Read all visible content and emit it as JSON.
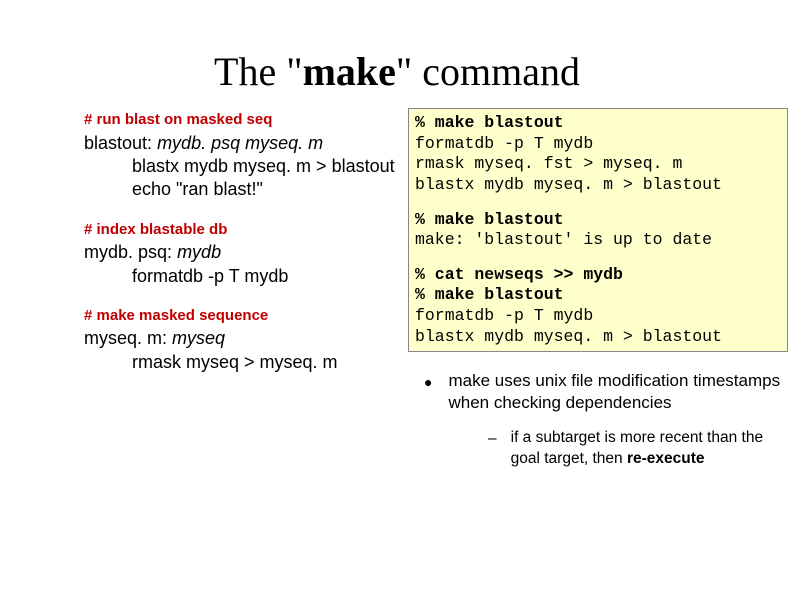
{
  "title_pre": "The \"",
  "title_bold": "make",
  "title_post": "\" command",
  "left": {
    "c1": "# run blast on masked seq",
    "t1_target": "blastout:",
    "t1_dep1": "mydb. psq",
    "t1_dep2": "myseq. m",
    "t1_r1": "blastx mydb myseq. m > blastout",
    "t1_r2": "echo \"ran blast!\"",
    "c2": "# index blastable db",
    "t2_target": "mydb. psq:",
    "t2_dep": "mydb",
    "t2_r1": "formatdb -p T mydb",
    "c3": "# make masked sequence",
    "t3_target": "myseq. m:",
    "t3_dep": "myseq",
    "t3_r1": "rmask myseq > myseq. m"
  },
  "term": {
    "l1": "% make blastout",
    "l2": "formatdb -p T mydb",
    "l3": "rmask myseq. fst > myseq. m",
    "l4": "blastx mydb myseq. m > blastout",
    "l5": "% make blastout",
    "l6": "make: 'blastout' is up to date",
    "l7": "% cat newseqs >> mydb",
    "l8": "% make blastout",
    "l9": "formatdb -p T mydb",
    "l10": "blastx mydb myseq. m > blastout"
  },
  "bullet1": "make uses unix file modification timestamps when checking dependencies",
  "bullet2_pre": "if a subtarget is more recent than the goal target, then ",
  "bullet2_bold": "re-execute"
}
